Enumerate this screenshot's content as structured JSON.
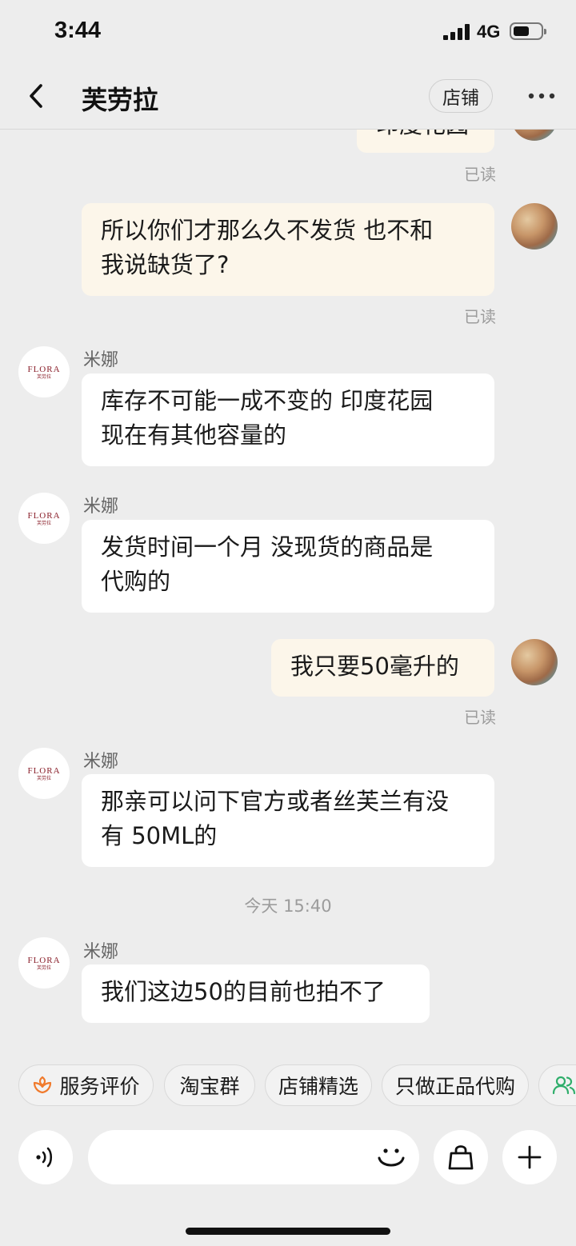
{
  "status_bar": {
    "time": "3:44",
    "network": "4G",
    "battery_level": 0.6,
    "signal_bars": 4
  },
  "header": {
    "title": "芙劳拉",
    "shop_label": "店铺"
  },
  "messages": [
    {
      "type": "mine",
      "text": "印度花园",
      "read": "已读"
    },
    {
      "type": "mine",
      "text_line1": "所以你们才那么久不发货 也不和",
      "text_line2": "我说缺货了?",
      "read": "已读"
    },
    {
      "type": "theirs",
      "sender": "米娜",
      "text_line1": "库存不可能一成不变的  印度花园",
      "text_line2": "现在有其他容量的"
    },
    {
      "type": "theirs",
      "sender": "米娜",
      "text_line1": "发货时间一个月  没现货的商品是",
      "text_line2": "代购的"
    },
    {
      "type": "mine",
      "text": "我只要50毫升的",
      "read": "已读"
    },
    {
      "type": "theirs",
      "sender": "米娜",
      "text_line1": "那亲可以问下官方或者丝芙兰有没",
      "text_line2": "有 50ML的"
    },
    {
      "type": "timestamp",
      "text": "今天 15:40"
    },
    {
      "type": "theirs",
      "sender": "米娜",
      "text": "我们这边50的目前也拍不了"
    }
  ],
  "shop_avatar": {
    "logo_text": "FLORA",
    "logo_sub": "芙劳拉"
  },
  "chips": [
    "服务评价",
    "淘宝群",
    "店铺精选",
    "只做正品代购"
  ],
  "colors": {
    "mine_bubble": "#fcf6ea",
    "theirs_bubble": "#ffffff",
    "background": "#ededed",
    "chip_icon": "#f07a2c",
    "group_icon": "#2fae6b"
  }
}
